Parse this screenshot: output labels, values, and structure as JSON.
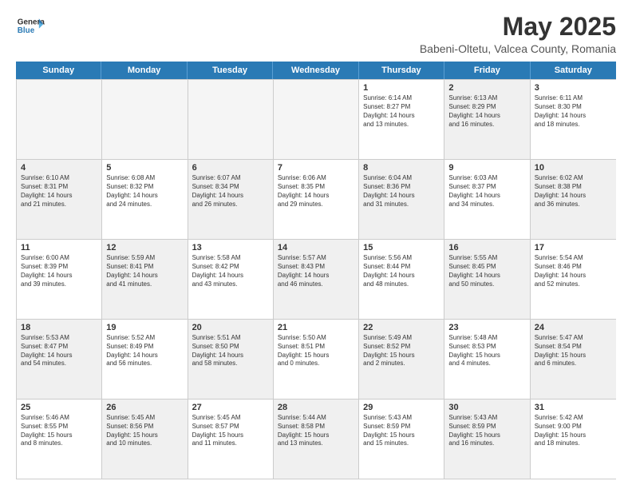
{
  "logo": {
    "general": "General",
    "blue": "Blue"
  },
  "title": "May 2025",
  "subtitle": "Babeni-Oltetu, Valcea County, Romania",
  "headers": [
    "Sunday",
    "Monday",
    "Tuesday",
    "Wednesday",
    "Thursday",
    "Friday",
    "Saturday"
  ],
  "weeks": [
    [
      {
        "day": "",
        "info": "",
        "empty": true
      },
      {
        "day": "",
        "info": "",
        "empty": true
      },
      {
        "day": "",
        "info": "",
        "empty": true
      },
      {
        "day": "",
        "info": "",
        "empty": true
      },
      {
        "day": "1",
        "info": "Sunrise: 6:14 AM\nSunset: 8:27 PM\nDaylight: 14 hours\nand 13 minutes."
      },
      {
        "day": "2",
        "info": "Sunrise: 6:13 AM\nSunset: 8:29 PM\nDaylight: 14 hours\nand 16 minutes.",
        "shaded": true
      },
      {
        "day": "3",
        "info": "Sunrise: 6:11 AM\nSunset: 8:30 PM\nDaylight: 14 hours\nand 18 minutes."
      }
    ],
    [
      {
        "day": "4",
        "info": "Sunrise: 6:10 AM\nSunset: 8:31 PM\nDaylight: 14 hours\nand 21 minutes.",
        "shaded": true
      },
      {
        "day": "5",
        "info": "Sunrise: 6:08 AM\nSunset: 8:32 PM\nDaylight: 14 hours\nand 24 minutes."
      },
      {
        "day": "6",
        "info": "Sunrise: 6:07 AM\nSunset: 8:34 PM\nDaylight: 14 hours\nand 26 minutes.",
        "shaded": true
      },
      {
        "day": "7",
        "info": "Sunrise: 6:06 AM\nSunset: 8:35 PM\nDaylight: 14 hours\nand 29 minutes."
      },
      {
        "day": "8",
        "info": "Sunrise: 6:04 AM\nSunset: 8:36 PM\nDaylight: 14 hours\nand 31 minutes.",
        "shaded": true
      },
      {
        "day": "9",
        "info": "Sunrise: 6:03 AM\nSunset: 8:37 PM\nDaylight: 14 hours\nand 34 minutes."
      },
      {
        "day": "10",
        "info": "Sunrise: 6:02 AM\nSunset: 8:38 PM\nDaylight: 14 hours\nand 36 minutes.",
        "shaded": true
      }
    ],
    [
      {
        "day": "11",
        "info": "Sunrise: 6:00 AM\nSunset: 8:39 PM\nDaylight: 14 hours\nand 39 minutes."
      },
      {
        "day": "12",
        "info": "Sunrise: 5:59 AM\nSunset: 8:41 PM\nDaylight: 14 hours\nand 41 minutes.",
        "shaded": true
      },
      {
        "day": "13",
        "info": "Sunrise: 5:58 AM\nSunset: 8:42 PM\nDaylight: 14 hours\nand 43 minutes."
      },
      {
        "day": "14",
        "info": "Sunrise: 5:57 AM\nSunset: 8:43 PM\nDaylight: 14 hours\nand 46 minutes.",
        "shaded": true
      },
      {
        "day": "15",
        "info": "Sunrise: 5:56 AM\nSunset: 8:44 PM\nDaylight: 14 hours\nand 48 minutes."
      },
      {
        "day": "16",
        "info": "Sunrise: 5:55 AM\nSunset: 8:45 PM\nDaylight: 14 hours\nand 50 minutes.",
        "shaded": true
      },
      {
        "day": "17",
        "info": "Sunrise: 5:54 AM\nSunset: 8:46 PM\nDaylight: 14 hours\nand 52 minutes."
      }
    ],
    [
      {
        "day": "18",
        "info": "Sunrise: 5:53 AM\nSunset: 8:47 PM\nDaylight: 14 hours\nand 54 minutes.",
        "shaded": true
      },
      {
        "day": "19",
        "info": "Sunrise: 5:52 AM\nSunset: 8:49 PM\nDaylight: 14 hours\nand 56 minutes."
      },
      {
        "day": "20",
        "info": "Sunrise: 5:51 AM\nSunset: 8:50 PM\nDaylight: 14 hours\nand 58 minutes.",
        "shaded": true
      },
      {
        "day": "21",
        "info": "Sunrise: 5:50 AM\nSunset: 8:51 PM\nDaylight: 15 hours\nand 0 minutes."
      },
      {
        "day": "22",
        "info": "Sunrise: 5:49 AM\nSunset: 8:52 PM\nDaylight: 15 hours\nand 2 minutes.",
        "shaded": true
      },
      {
        "day": "23",
        "info": "Sunrise: 5:48 AM\nSunset: 8:53 PM\nDaylight: 15 hours\nand 4 minutes."
      },
      {
        "day": "24",
        "info": "Sunrise: 5:47 AM\nSunset: 8:54 PM\nDaylight: 15 hours\nand 6 minutes.",
        "shaded": true
      }
    ],
    [
      {
        "day": "25",
        "info": "Sunrise: 5:46 AM\nSunset: 8:55 PM\nDaylight: 15 hours\nand 8 minutes."
      },
      {
        "day": "26",
        "info": "Sunrise: 5:45 AM\nSunset: 8:56 PM\nDaylight: 15 hours\nand 10 minutes.",
        "shaded": true
      },
      {
        "day": "27",
        "info": "Sunrise: 5:45 AM\nSunset: 8:57 PM\nDaylight: 15 hours\nand 11 minutes."
      },
      {
        "day": "28",
        "info": "Sunrise: 5:44 AM\nSunset: 8:58 PM\nDaylight: 15 hours\nand 13 minutes.",
        "shaded": true
      },
      {
        "day": "29",
        "info": "Sunrise: 5:43 AM\nSunset: 8:59 PM\nDaylight: 15 hours\nand 15 minutes."
      },
      {
        "day": "30",
        "info": "Sunrise: 5:43 AM\nSunset: 8:59 PM\nDaylight: 15 hours\nand 16 minutes.",
        "shaded": true
      },
      {
        "day": "31",
        "info": "Sunrise: 5:42 AM\nSunset: 9:00 PM\nDaylight: 15 hours\nand 18 minutes."
      }
    ]
  ]
}
